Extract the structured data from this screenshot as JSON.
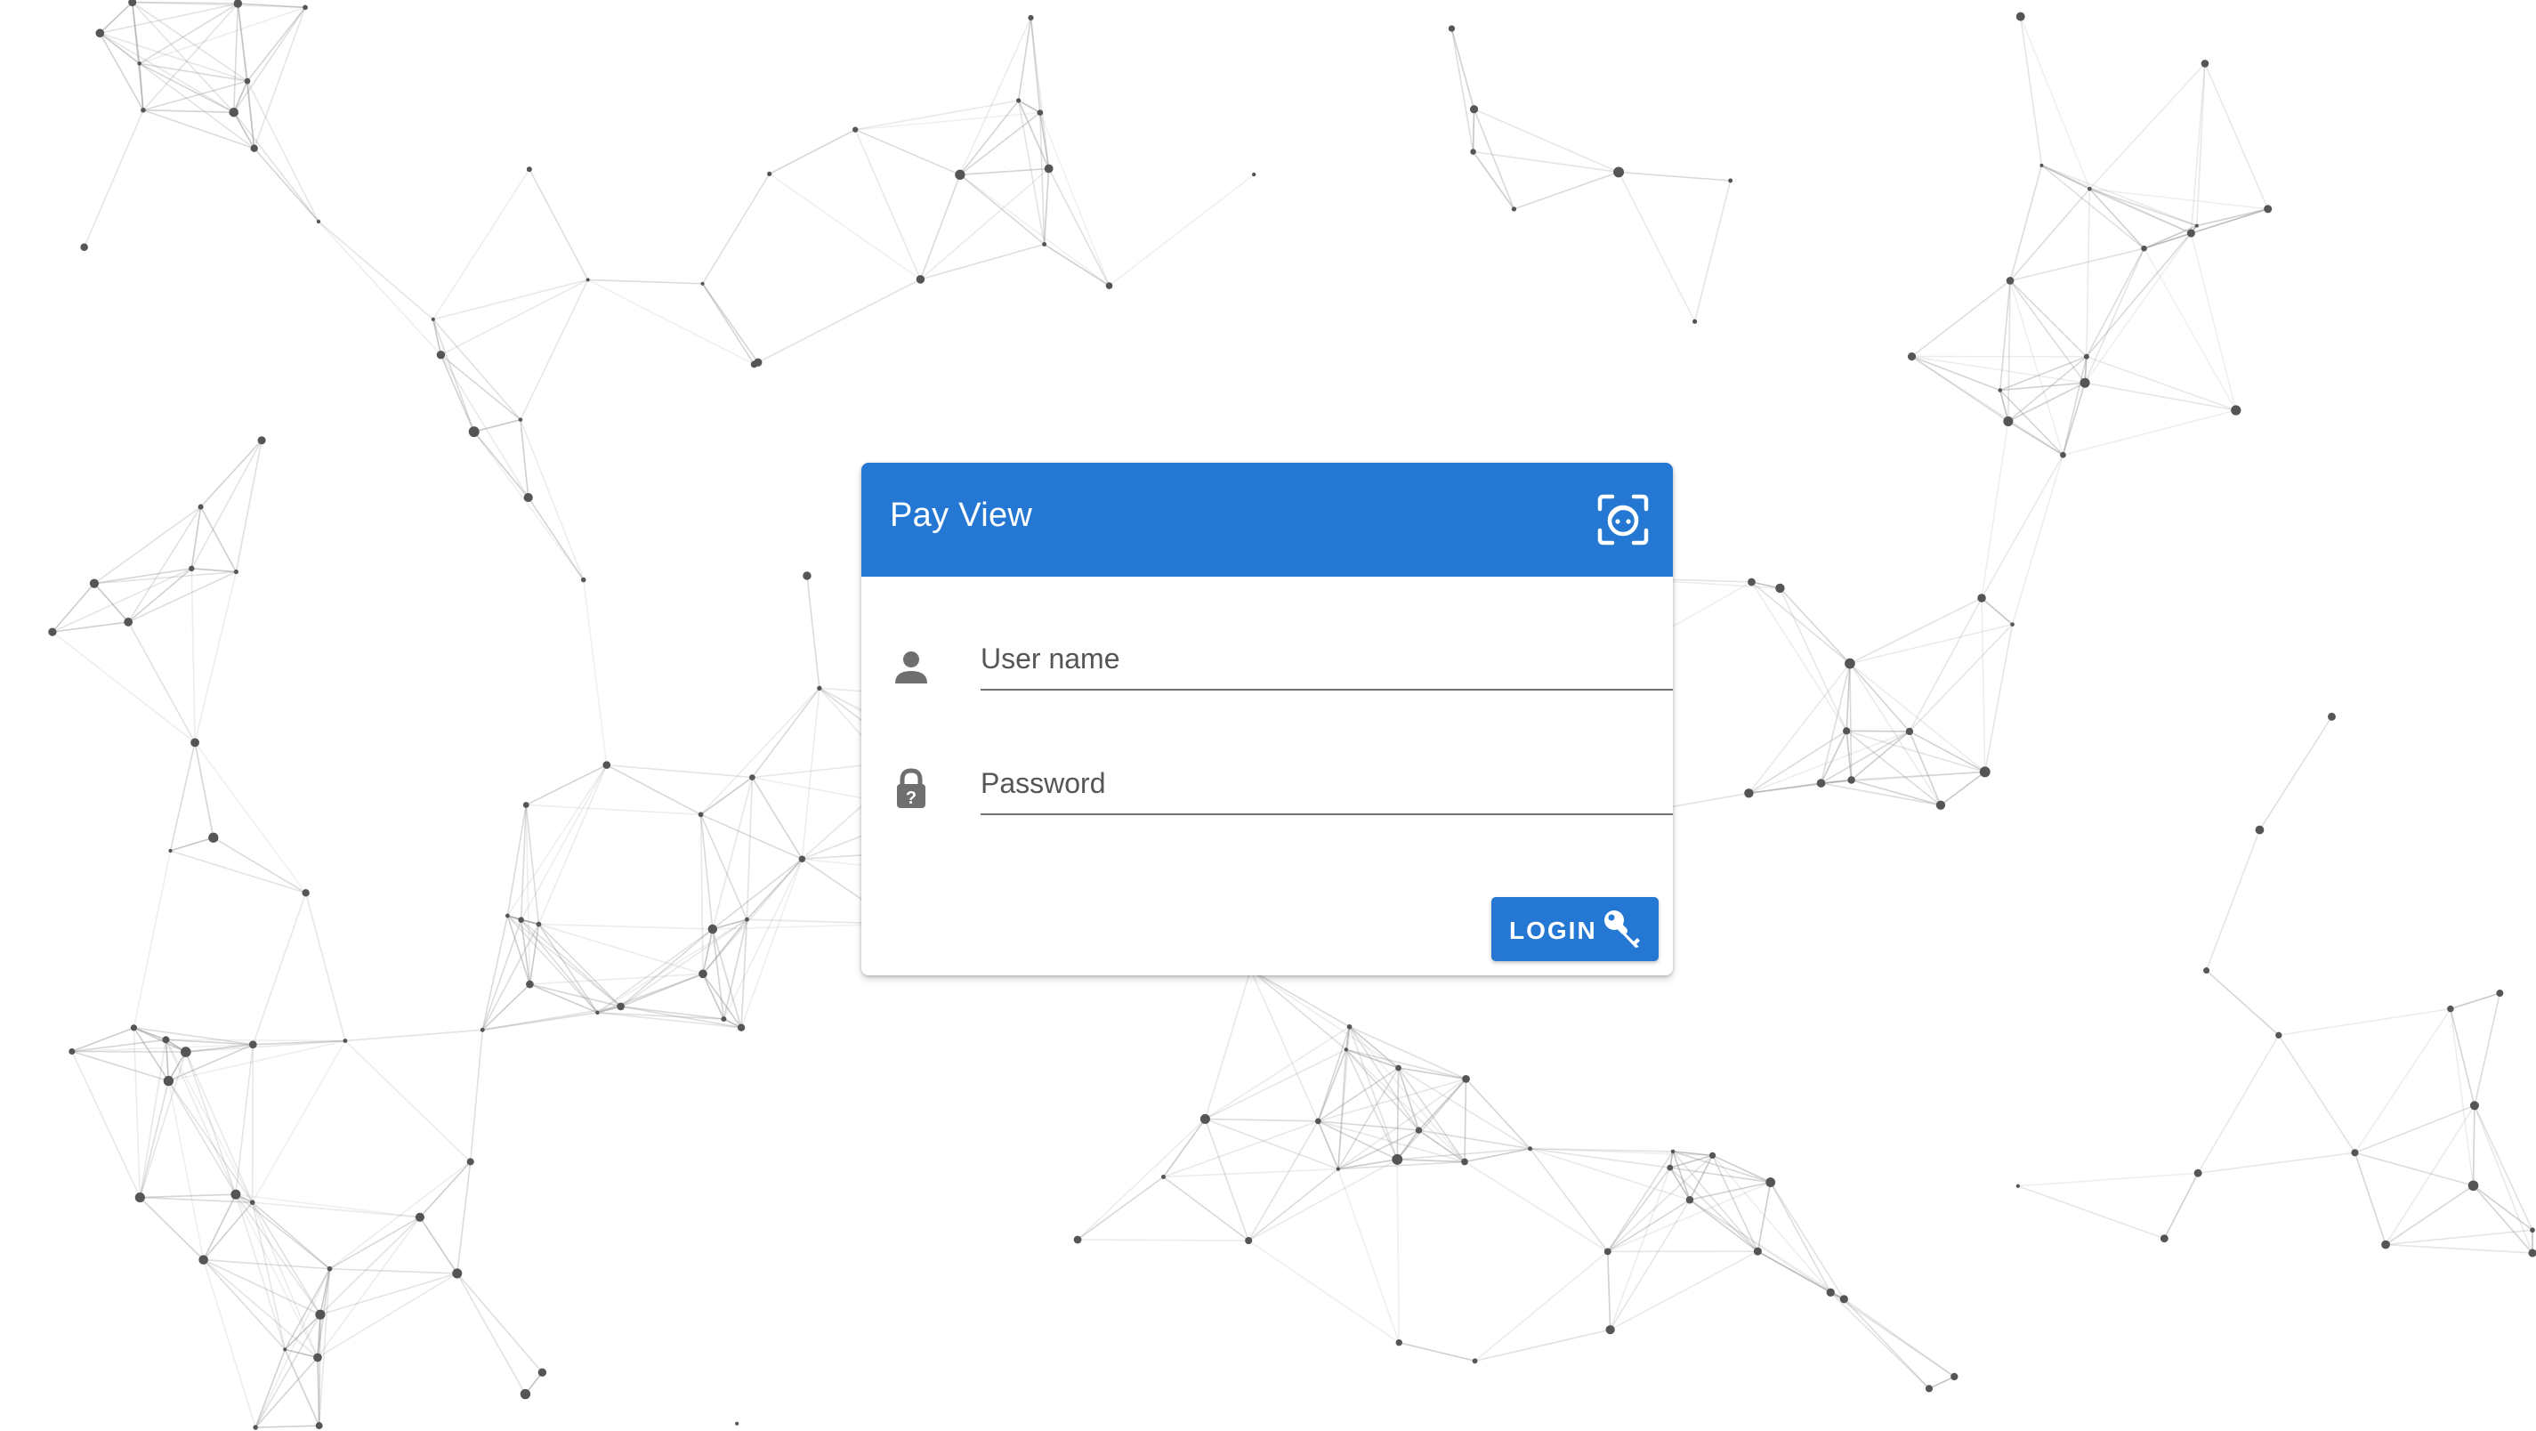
{
  "app": {
    "title": "Pay View"
  },
  "form": {
    "username": {
      "placeholder": "User name",
      "value": "",
      "icon": "person-icon"
    },
    "password": {
      "placeholder": "Password",
      "value": "",
      "icon": "lock-question-icon"
    },
    "login_label": "LOGIN",
    "login_icon": "key-icon",
    "face_login_icon": "face-recognition-icon"
  },
  "colors": {
    "primary": "#2477d2",
    "header_text": "#ffffff",
    "icon_gray": "#6f6f6f",
    "network_lines": "#9a9a9a",
    "network_nodes": "#555555"
  }
}
